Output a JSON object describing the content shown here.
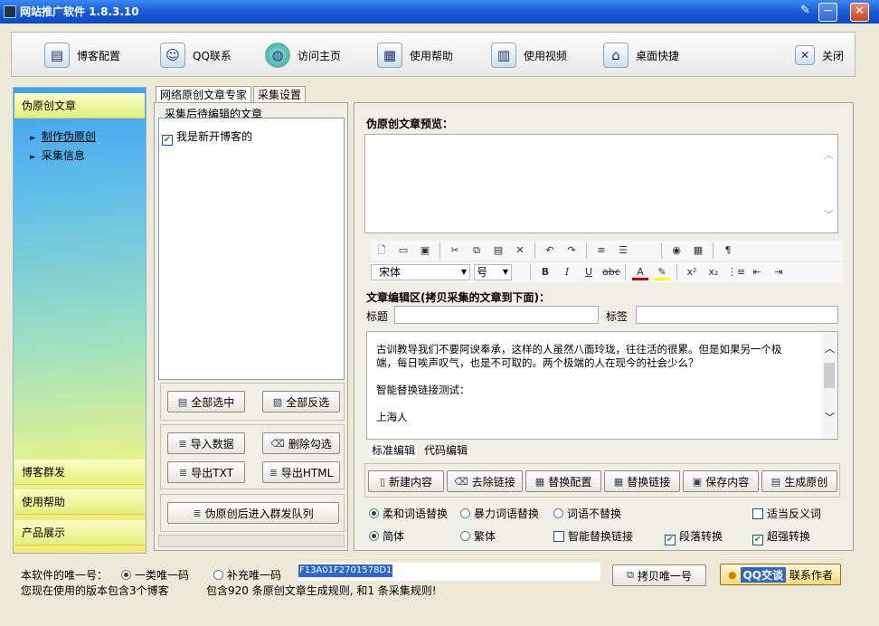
{
  "window": {
    "title": "网站推广软件 1.8.3.10",
    "min": "─",
    "max": "□",
    "close": "✕",
    "pin": "✎"
  },
  "toolbar": {
    "items": [
      {
        "key": "blog_config",
        "label": "博客配置",
        "icon": "document-icon"
      },
      {
        "key": "qq_contact",
        "label": "QQ联系",
        "icon": "person-icon"
      },
      {
        "key": "visit_home",
        "label": "访问主页",
        "icon": "globe-icon"
      },
      {
        "key": "help",
        "label": "使用帮助",
        "icon": "help-doc-icon"
      },
      {
        "key": "video",
        "label": "使用视频",
        "icon": "video-doc-icon"
      },
      {
        "key": "shortcut",
        "label": "桌面快捷",
        "icon": "shortcut-icon"
      },
      {
        "key": "close",
        "label": "关闭",
        "icon": "close-icon"
      }
    ]
  },
  "sidebar": {
    "top_header": "伪原创文章",
    "links": [
      "制作伪原创",
      "采集信息"
    ],
    "bottom_headers": [
      "博客群发",
      "使用帮助",
      "产品展示"
    ]
  },
  "left_tabs": [
    "网络原创文章专家",
    "采集设置"
  ],
  "pending": {
    "group_label": "采集后待编辑的文章",
    "items": [
      {
        "label": "我是新开博客的",
        "checked": true
      }
    ]
  },
  "left_buttons": {
    "select_all": "全部选中",
    "invert": "全部反选",
    "import": "导入数据",
    "delete_checked": "删除勾选",
    "export_txt": "导出TXT",
    "export_html": "导出HTML",
    "queue": "伪原创后进入群发队列"
  },
  "preview": {
    "label": "伪原创文章预览："
  },
  "editor": {
    "font_name": "宋体",
    "font_size": "号",
    "section_label": "文章编辑区(拷贝采集的文章到下面)：",
    "title_label": "标题",
    "tag_label": "标签",
    "content_lines": [
      "古训教导我们不要阿谀奉承，这样的人虽然八面玲珑，往往活的很累。但是如果另一个极",
      "端，每日唉声叹气，也是不可取的。两个极端的人在现今的社会少么？",
      "",
      "智能替换链接测试：",
      "",
      "上海人"
    ],
    "mode_tabs": [
      "标准编辑",
      "代码编辑"
    ]
  },
  "action_buttons": [
    "新建内容",
    "去除链接",
    "替换配置",
    "替换链接",
    "保存内容",
    "生成原创"
  ],
  "options": {
    "row1": [
      {
        "label": "柔和词语替换",
        "type": "radio",
        "checked": true
      },
      {
        "label": "暴力词语替换",
        "type": "radio",
        "checked": false
      },
      {
        "label": "词语不替换",
        "type": "radio",
        "checked": false
      },
      {
        "label": "适当反义词",
        "type": "checkbox",
        "checked": false
      }
    ],
    "row2": [
      {
        "label": "简体",
        "type": "radio",
        "checked": true
      },
      {
        "label": "繁体",
        "type": "radio",
        "checked": false
      },
      {
        "label": "智能替换链接",
        "type": "checkbox",
        "checked": false
      },
      {
        "label": "段落转换",
        "type": "checkbox",
        "checked": true
      },
      {
        "label": "超强转换",
        "type": "checkbox",
        "checked": true
      }
    ]
  },
  "status": {
    "unique_label": "本软件的唯一号：",
    "radio1": "一类唯一码",
    "radio2": "补充唯一码",
    "unique_value": "F13A01F2701578D1",
    "copy_button": "拷贝唯一号",
    "qq_button": "QQ交谈",
    "contact_author": "联系作者",
    "version_info": "您现在使用的版本包含3个博客",
    "rules_info": "包含920 条原创文章生成规则, 和1 条采集规则!"
  },
  "colors": {
    "title_bar": "#1a5fd8",
    "selection": "#3168c6"
  }
}
